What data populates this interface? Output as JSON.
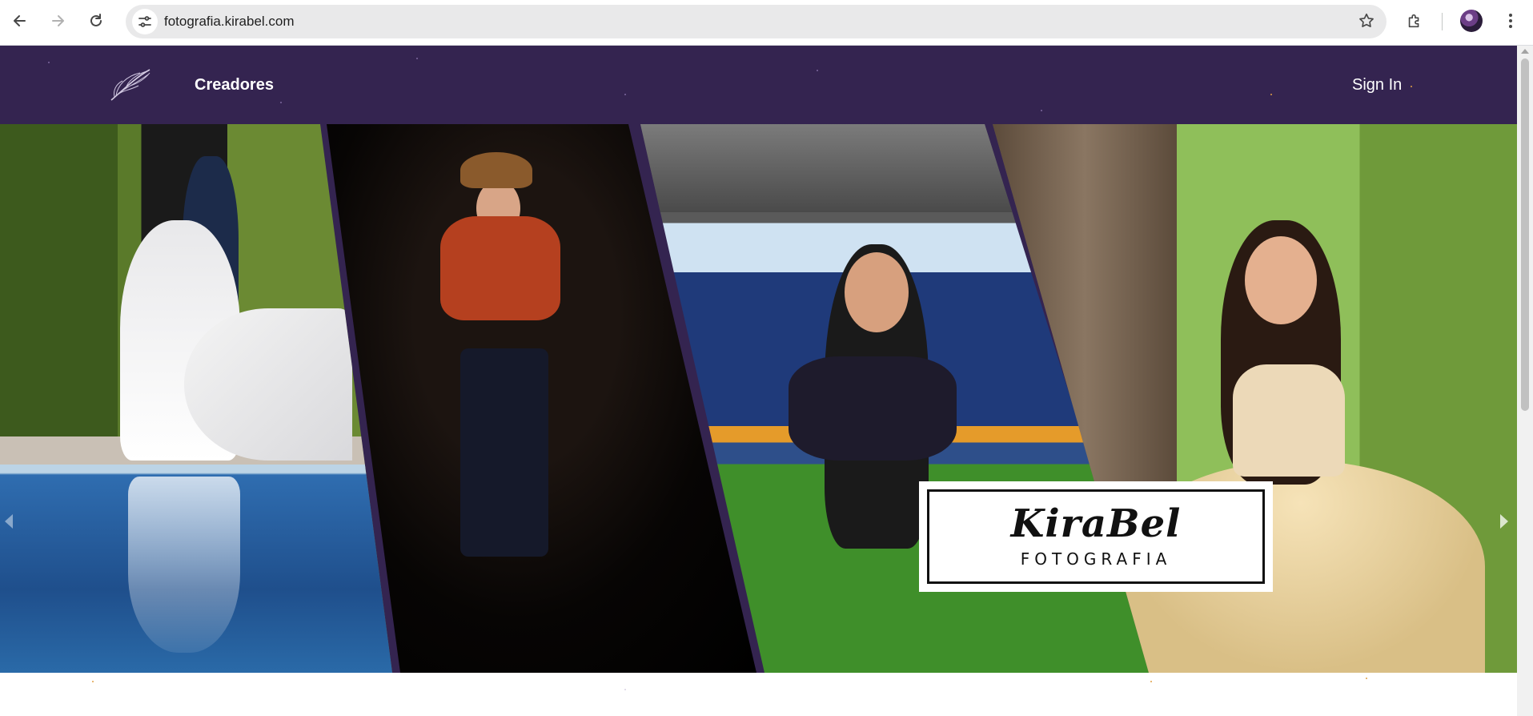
{
  "browser": {
    "url": "fotografia.kirabel.com",
    "icons": [
      "back-arrow-icon",
      "forward-arrow-icon",
      "reload-icon",
      "site-info-icon",
      "bookmark-star-icon",
      "extensions-puzzle-icon",
      "profile-avatar",
      "menu-kebab-icon"
    ]
  },
  "site": {
    "nav": {
      "creadores": "Creadores",
      "sign_in": "Sign In"
    },
    "colors": {
      "header_bg": "#342450",
      "text": "#ffffff"
    }
  },
  "hero": {
    "brand": {
      "name": "KiraBel",
      "subtitle": "FOTOGRAFIA"
    },
    "slides": [
      "wedding-couple-photo",
      "woman-cowboy-hat-photo",
      "softball-player-photo",
      "quinceanera-photo"
    ],
    "indicators": {
      "count": 2,
      "active_index": 0
    }
  }
}
